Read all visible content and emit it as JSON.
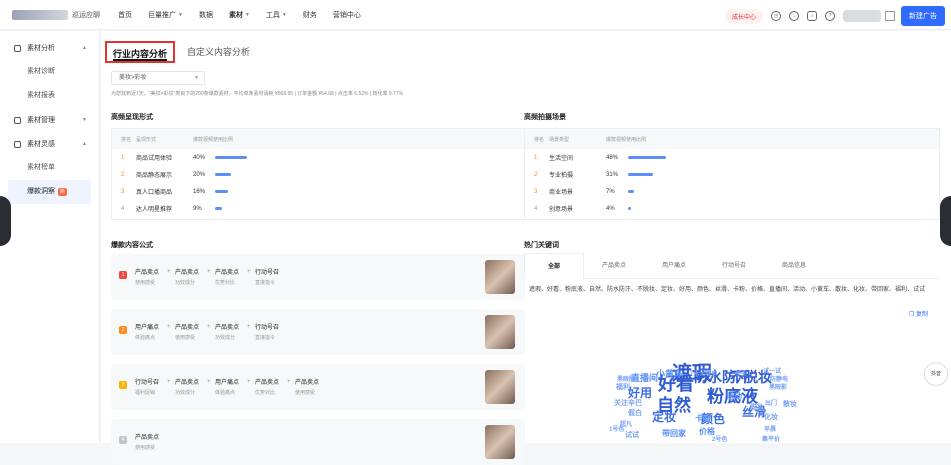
{
  "topbar": {
    "org_label": "巡运应聊",
    "nav": [
      {
        "label": "首页",
        "caret": false,
        "active": false
      },
      {
        "label": "巨量推广",
        "caret": true,
        "active": false
      },
      {
        "label": "数据",
        "caret": false,
        "active": false
      },
      {
        "label": "素材",
        "caret": true,
        "active": true
      },
      {
        "label": "工具",
        "caret": true,
        "active": false
      },
      {
        "label": "财务",
        "caret": false,
        "active": false
      },
      {
        "label": "营销中心",
        "caret": false,
        "active": false
      }
    ],
    "growth_center": "成长中心",
    "new_ad_button": "新建广告"
  },
  "sidebar": {
    "groups": [
      {
        "label": "素材分析",
        "items": [
          {
            "label": "素材诊断",
            "active": false
          },
          {
            "label": "素材报表",
            "active": false
          }
        ]
      },
      {
        "label": "素材管理",
        "items": []
      },
      {
        "label": "素材灵感",
        "items": [
          {
            "label": "素材榜单",
            "active": false
          },
          {
            "label": "爆款洞察",
            "active": true,
            "badge": "新"
          }
        ]
      }
    ]
  },
  "main": {
    "tabs": [
      {
        "label": "行业内容分析",
        "active": true
      },
      {
        "label": "自定义内容分析",
        "active": false
      }
    ],
    "industry_select": "美妆>彩妆",
    "summary": "为您找到近7天，\"美妆>彩妆\"类目下的200条爆款素材，平均单条素材消耗 ¥568.95 | 订单金额 ¥54.68 | 点击率 6.52% | 转化率 9.77%",
    "form_panel": {
      "title": "高频呈现形式",
      "headers": [
        "排名",
        "呈现形式",
        "爆款视频使用比例"
      ],
      "rows": [
        {
          "rank": "1",
          "name": "商品试用体验",
          "percent": "40%",
          "ratio": 0.4
        },
        {
          "rank": "2",
          "name": "商品静态展示",
          "percent": "20%",
          "ratio": 0.2
        },
        {
          "rank": "3",
          "name": "真人口播商品",
          "percent": "16%",
          "ratio": 0.16
        },
        {
          "rank": "4",
          "name": "达人明星推荐",
          "percent": "9%",
          "ratio": 0.09
        }
      ]
    },
    "scene_panel": {
      "title": "高频拍摄场景",
      "headers": [
        "排名",
        "场景类型",
        "爆款视频使用比例"
      ],
      "rows": [
        {
          "rank": "1",
          "name": "生活空间",
          "percent": "48%",
          "ratio": 0.48
        },
        {
          "rank": "2",
          "name": "专业拍摄",
          "percent": "31%",
          "ratio": 0.31
        },
        {
          "rank": "3",
          "name": "商业场景",
          "percent": "7%",
          "ratio": 0.07
        },
        {
          "rank": "4",
          "name": "创意场景",
          "percent": "4%",
          "ratio": 0.04
        }
      ]
    },
    "formula_panel": {
      "title": "爆款内容公式",
      "cards": [
        {
          "rank": "1",
          "color": "#f0483e",
          "items": [
            {
              "t": "产品卖点",
              "s": "使用感受"
            },
            {
              "t": "产品卖点",
              "s": "功效成分"
            },
            {
              "t": "产品卖点",
              "s": "优势对比"
            },
            {
              "t": "行动号召",
              "s": "直接指令"
            }
          ]
        },
        {
          "rank": "2",
          "color": "#ff8a1f",
          "items": [
            {
              "t": "用户痛点",
              "s": "体验痛点"
            },
            {
              "t": "产品卖点",
              "s": "使用感受"
            },
            {
              "t": "产品卖点",
              "s": "功效成分"
            },
            {
              "t": "行动号召",
              "s": "直接指令"
            }
          ]
        },
        {
          "rank": "3",
          "color": "#ffb300",
          "items": [
            {
              "t": "行动号召",
              "s": "福利促销"
            },
            {
              "t": "产品卖点",
              "s": "功效成分"
            },
            {
              "t": "用户痛点",
              "s": "体验痛点"
            },
            {
              "t": "产品卖点",
              "s": "优势对比"
            },
            {
              "t": "产品卖点",
              "s": "使用感受"
            }
          ]
        },
        {
          "rank": "4",
          "color": "#c0c4cc",
          "items": [
            {
              "t": "产品卖点",
              "s": "使用感受"
            }
          ]
        }
      ]
    },
    "keyword_panel": {
      "title": "热门关键词",
      "tabs": [
        {
          "label": "全部",
          "active": true
        },
        {
          "label": "产品卖点",
          "active": false
        },
        {
          "label": "用户痛点",
          "active": false
        },
        {
          "label": "行动号召",
          "active": false
        },
        {
          "label": "商品信息",
          "active": false
        }
      ],
      "keyword_list": "遮瑕、好看、粉底液、自然、防水防汗、不脱妆、定妆、好用、颜色、丝滑、卡粉、价格、直播间、活动、小黄车、散妆、化妆、带回家、福利、试试",
      "copy_label": "复制",
      "cloud": [
        {
          "t": "遮瑕",
          "c": "#2f5bd3",
          "s": 20
        },
        {
          "t": "自然",
          "c": "#2f5bd3",
          "s": 17
        },
        {
          "t": "好看",
          "c": "#2f5bd3",
          "s": 18
        },
        {
          "t": "粉底液",
          "c": "#2f5bd3",
          "s": 17
        },
        {
          "t": "防水防汗",
          "c": "#2f5bd3",
          "s": 14
        },
        {
          "t": "不脱妆",
          "c": "#2f5bd3",
          "s": 14
        },
        {
          "t": "丝滑",
          "c": "#3d6ee0",
          "s": 12
        },
        {
          "t": "颜色",
          "c": "#3d6ee0",
          "s": 12
        },
        {
          "t": "定妆",
          "c": "#3d6ee0",
          "s": 12
        },
        {
          "t": "好用",
          "c": "#3d6ee0",
          "s": 12
        },
        {
          "t": "直播间",
          "c": "#5b8ff9",
          "s": 9
        },
        {
          "t": "小黄车",
          "c": "#5b8ff9",
          "s": 9
        },
        {
          "t": "卡粉",
          "c": "#5b8ff9",
          "s": 8
        },
        {
          "t": "价格",
          "c": "#5b8ff9",
          "s": 8
        },
        {
          "t": "带回家",
          "c": "#5b8ff9",
          "s": 8
        },
        {
          "t": "活动",
          "c": "#5b8ff9",
          "s": 8
        },
        {
          "t": "福利",
          "c": "#7aa3f5",
          "s": 7
        },
        {
          "t": "试试",
          "c": "#7aa3f5",
          "s": 7
        },
        {
          "t": "脱妆",
          "c": "#7aa3f5",
          "s": 7
        },
        {
          "t": "化妆",
          "c": "#7aa3f5",
          "s": 7
        },
        {
          "t": "散妆",
          "c": "#7aa3f5",
          "s": 7
        },
        {
          "t": "假白",
          "c": "#7aa3f5",
          "s": 7
        },
        {
          "t": "关注辛巴",
          "c": "#7aa3f5",
          "s": 7
        },
        {
          "t": "黑眼圈",
          "c": "#7aa3f5",
          "s": 6
        },
        {
          "t": "7天无理由",
          "c": "#7aa3f5",
          "s": 6
        },
        {
          "t": "试一试",
          "c": "#7aa3f5",
          "s": 6
        },
        {
          "t": "冬天",
          "c": "#7aa3f5",
          "s": 6
        },
        {
          "t": "黑眼影",
          "c": "#7aa3f5",
          "s": 6
        },
        {
          "t": "早晨",
          "c": "#7aa3f5",
          "s": 6
        },
        {
          "t": "防静电",
          "c": "#7aa3f5",
          "s": 6
        },
        {
          "t": "2号色",
          "c": "#7aa3f5",
          "s": 6
        },
        {
          "t": "出门",
          "c": "#7aa3f5",
          "s": 6
        },
        {
          "t": "集平价",
          "c": "#7aa3f5",
          "s": 6
        },
        {
          "t": "超凡",
          "c": "#7aa3f5",
          "s": 6
        },
        {
          "t": "1号色",
          "c": "#7aa3f5",
          "s": 6
        }
      ]
    }
  },
  "float_logo": "抖音"
}
